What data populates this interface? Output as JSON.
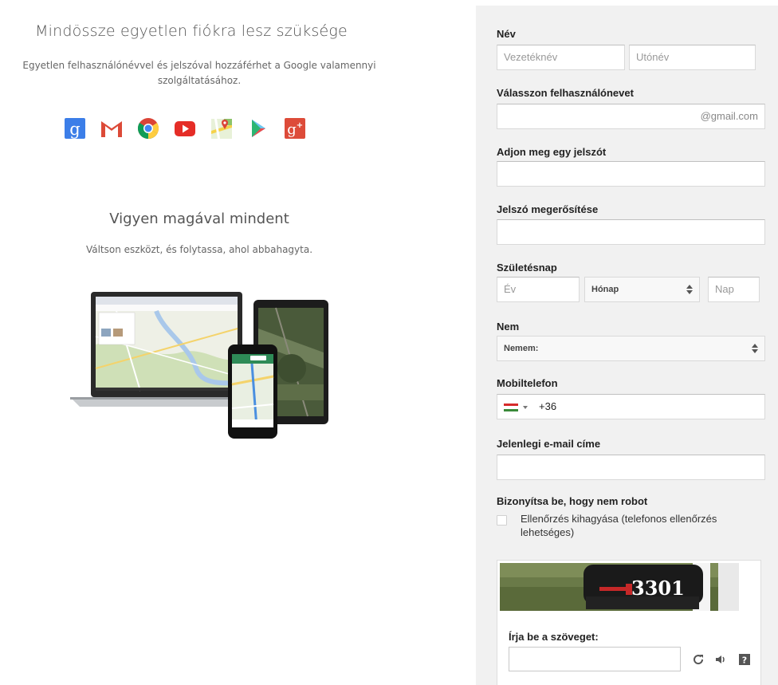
{
  "left": {
    "heading": "Mindössze egyetlen fiókra lesz szüksége",
    "subtitle_line1": "Egyetlen felhasználónévvel és jelszóval hozzáférhet a Google valamennyi",
    "subtitle_line2": "szolgáltatásához.",
    "service_icons": [
      "google-search-icon",
      "gmail-icon",
      "chrome-icon",
      "youtube-icon",
      "maps-icon",
      "play-store-icon",
      "google-plus-icon"
    ],
    "heading2": "Vigyen magával mindent",
    "subtitle2": "Váltson eszközt, és folytassa, ahol abbahagyta."
  },
  "form": {
    "name_label": "Név",
    "first_name_placeholder": "Vezetéknév",
    "last_name_placeholder": "Utónév",
    "username_label": "Válasszon felhasználónevet",
    "username_suffix": "@gmail.com",
    "password_label": "Adjon meg egy jelszót",
    "password_confirm_label": "Jelszó megerősítése",
    "birthday_label": "Születésnap",
    "year_placeholder": "Év",
    "month_value": "Hónap",
    "day_placeholder": "Nap",
    "gender_label": "Nem",
    "gender_value": "Nemem:",
    "phone_label": "Mobiltelefon",
    "phone_code": "+36",
    "email_label": "Jelenlegi e-mail címe",
    "robot_label": "Bizonyítsa be, hogy nem robot",
    "skip_verification_text": "Ellenőrzés kihagyása (telefonos ellenőrzés lehetséges)",
    "captcha_image_text": "3301",
    "captcha_label": "Írja be a szöveget:",
    "captcha_icons": [
      "refresh-icon",
      "audio-icon",
      "help-icon"
    ]
  },
  "colors": {
    "panel_bg": "#f1f1f1",
    "input_border": "#d9d9d9",
    "flag": [
      "#d62b2b",
      "#ffffff",
      "#3a8a3a"
    ]
  }
}
